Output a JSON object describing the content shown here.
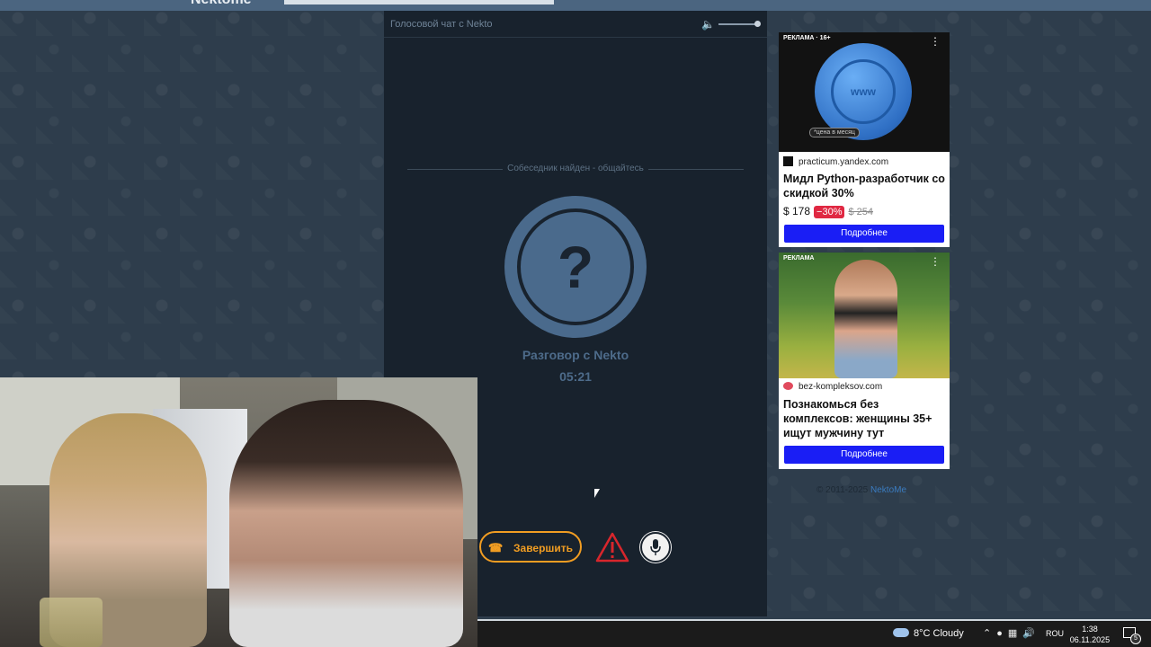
{
  "header": {
    "logo": "Nektome"
  },
  "chat": {
    "title": "Голосовой чат с Nekto",
    "found_status": "Собеседник найден - общайтесь",
    "avatar_symbol": "?",
    "conversation_label": "Разговор с Nekto",
    "timer": "05:21",
    "end_button": "Завершить",
    "report_icon": "warning-triangle",
    "mic_icon": "microphone"
  },
  "ads": [
    {
      "label": "РЕКЛАМА · 16+",
      "image_text": "www",
      "price_note": "*цена в месяц",
      "site": "practicum.yandex.com",
      "title": "Мидл Python-разработчик со скидкой 30%",
      "price": "$ 178",
      "discount": "−30%",
      "old_price": "$ 254",
      "button": "Подробнее"
    },
    {
      "label": "РЕКЛАМА",
      "site": "bez-kompleksov.com",
      "title": "Познакомься без комплексов: женщины 35+ ищут мужчину тут",
      "button": "Подробнее"
    }
  ],
  "footer": {
    "copyright": "© 2011-2025",
    "link": "NektoMe"
  },
  "taskbar": {
    "weather": "8°C  Cloudy",
    "lang": "ROU",
    "time": "1:38",
    "date": "06.11.2025",
    "notifications": "5"
  },
  "colors": {
    "accent_orange": "#f19d22",
    "avatar_blue": "#4a6a8c",
    "ad_button": "#1a1ef5",
    "panel_bg": "#18222d"
  }
}
